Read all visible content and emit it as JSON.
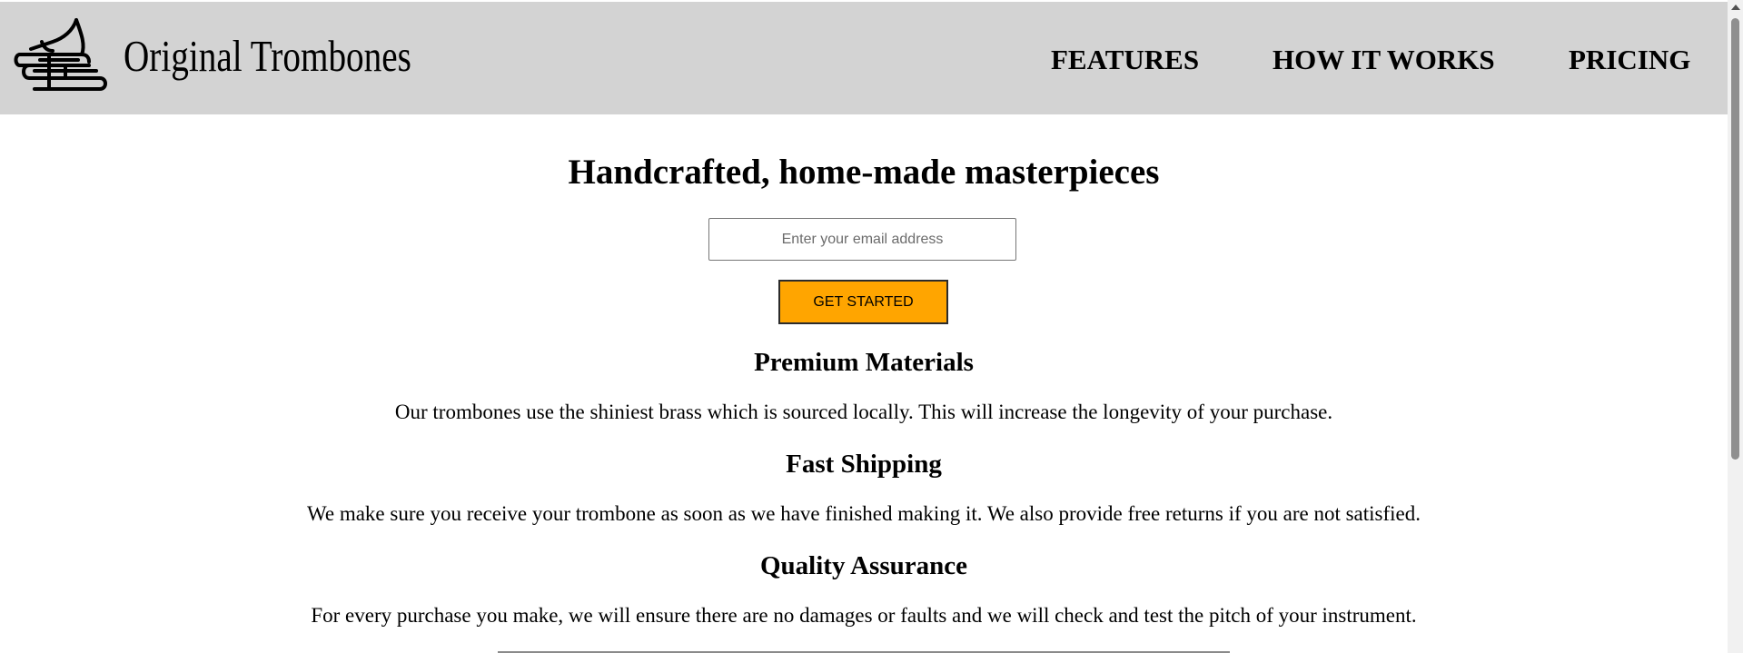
{
  "header": {
    "brand": "Original Trombones",
    "logo_icon": "trombone-icon",
    "nav": [
      {
        "label": "FEATURES"
      },
      {
        "label": "HOW IT WORKS"
      },
      {
        "label": "PRICING"
      }
    ]
  },
  "hero": {
    "title": "Handcrafted, home-made masterpieces",
    "email_placeholder": "Enter your email address",
    "cta_label": "GET STARTED"
  },
  "features": [
    {
      "heading": "Premium Materials",
      "text": "Our trombones use the shiniest brass which is sourced locally. This will increase the longevity of your purchase."
    },
    {
      "heading": "Fast Shipping",
      "text": "We make sure you receive your trombone as soon as we have finished making it. We also provide free returns if you are not satisfied."
    },
    {
      "heading": "Quality Assurance",
      "text": "For every purchase you make, we will ensure there are no damages or faults and we will check and test the pitch of your instrument."
    }
  ],
  "colors": {
    "header_bg": "#d3d3d3",
    "cta_bg": "#ffa500",
    "page_bg": "#ffffff"
  }
}
